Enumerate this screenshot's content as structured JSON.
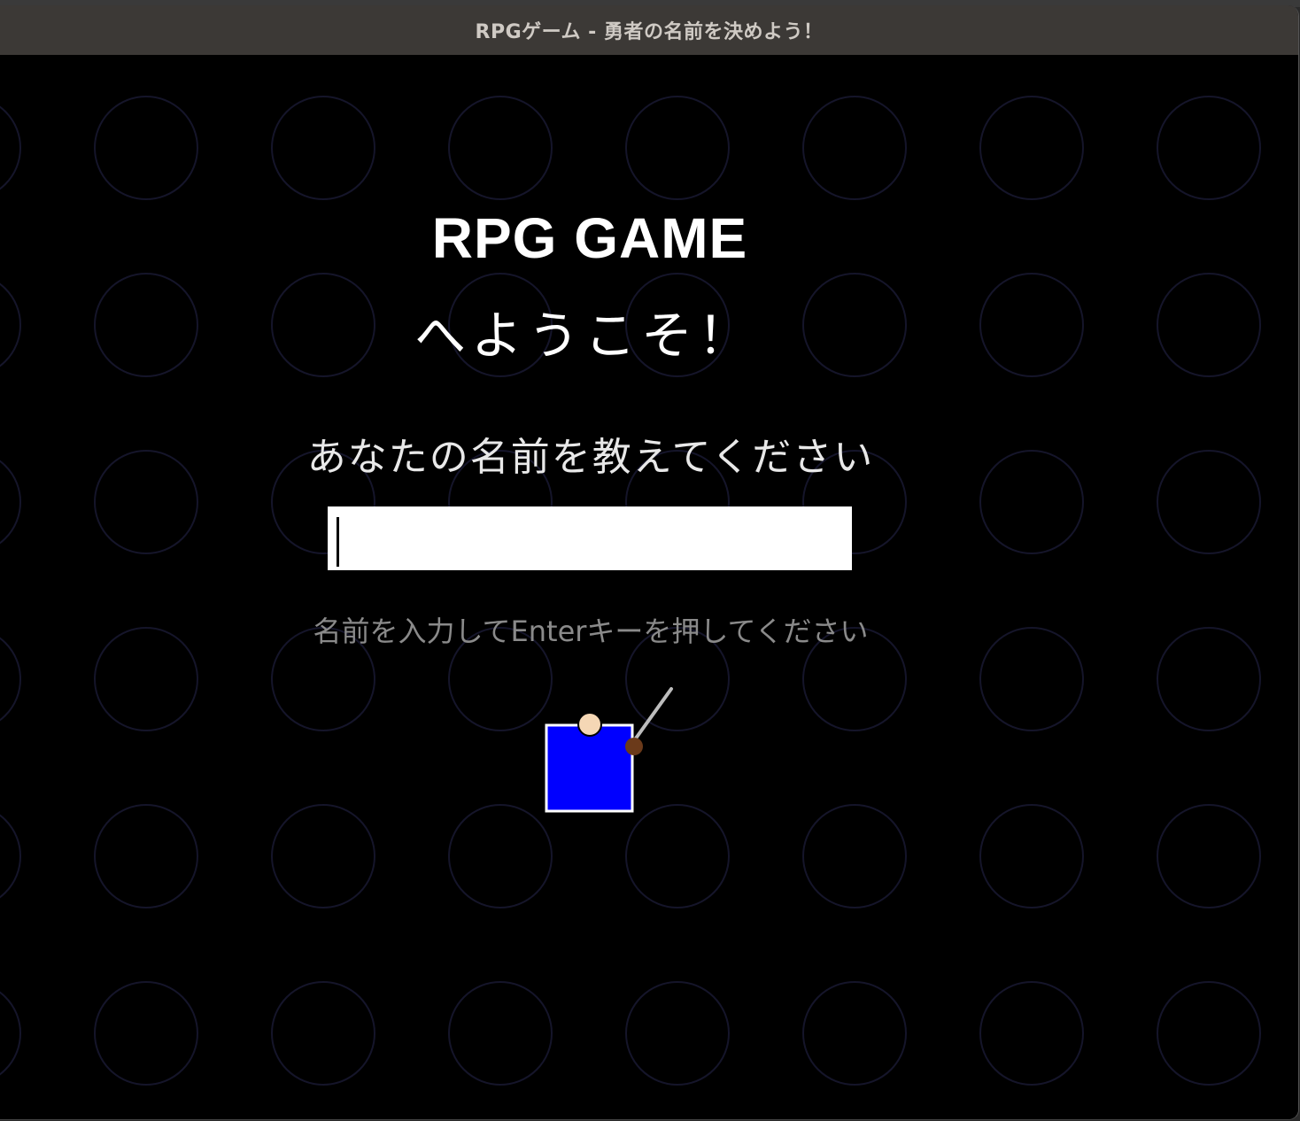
{
  "window": {
    "title": "RPGゲーム - 勇者の名前を決めよう！"
  },
  "screen": {
    "title": "RPG GAME",
    "welcome": "へようこそ！",
    "prompt": "あなたの名前を教えてください",
    "hint": "名前を入力してEnterキーを押してください"
  },
  "name_input": {
    "value": "",
    "placeholder": ""
  },
  "hero": {
    "icon": "hero-sprite-icon",
    "body_color": "#0000ff",
    "head_color": "#f5d7b5",
    "hand_color": "#6b3a1a",
    "sword_color": "#bdbdbd"
  },
  "colors": {
    "background": "#000000",
    "title_text": "#ffffff",
    "hint_text": "#8a8a8a",
    "pattern_circle": "#15152a"
  }
}
